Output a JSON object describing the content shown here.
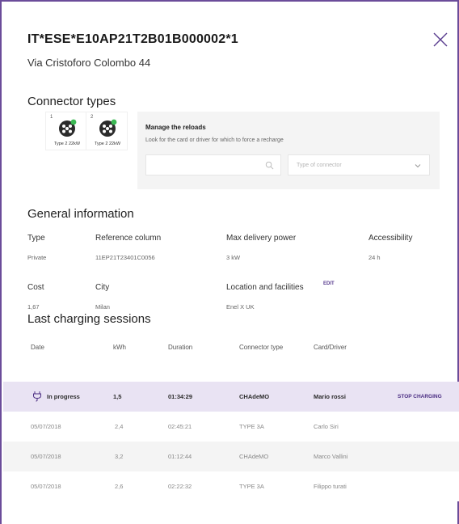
{
  "header": {
    "title": "IT*ESE*E10AP21T2B01B000002*1",
    "address": "Via Cristoforo Colombo 44"
  },
  "connectors": {
    "section_title": "Connector types",
    "items": [
      {
        "number": "1",
        "label": "Type 2 22kW"
      },
      {
        "number": "2",
        "label": "Type 2 22kW"
      }
    ],
    "colors": {
      "icon": "#2b2b2b",
      "status": "#3cba54"
    }
  },
  "reloads": {
    "title": "Manage the reloads",
    "description": "Look for the card or driver for which to force a recharge",
    "search_value": "",
    "connector_placeholder": "Type of connector"
  },
  "general": {
    "section_title": "General information",
    "fields": [
      {
        "label": "Type",
        "value": "Private"
      },
      {
        "label": "Reference column",
        "value": "11EP21T23401C0056"
      },
      {
        "label": "Max delivery power",
        "value": "3 kW"
      },
      {
        "label": "Accessibility",
        "value": "24 h"
      },
      {
        "label": "Cost",
        "value": "1,67"
      },
      {
        "label": "City",
        "value": "Milan"
      },
      {
        "label": "Location and facilities",
        "value": "Enel X UK"
      }
    ],
    "edit_label": "EDIT"
  },
  "sessions": {
    "section_title": "Last charging sessions",
    "columns": [
      "Date",
      "kWh",
      "Duration",
      "Connector type",
      "Card/Driver"
    ],
    "active": {
      "date": "In progress",
      "kwh": "1,5",
      "duration": "01:34:29",
      "connector": "CHAdeMO",
      "driver": "Mario rossi",
      "action": "STOP CHARGING"
    },
    "rows": [
      {
        "date": "05/07/2018",
        "kwh": "2,4",
        "duration": "02:45:21",
        "connector": "TYPE 3A",
        "driver": "Carlo Siri"
      },
      {
        "date": "05/07/2018",
        "kwh": "3,2",
        "duration": "01:12:44",
        "connector": "CHAdeMO",
        "driver": "Marco Vallini"
      },
      {
        "date": "05/07/2018",
        "kwh": "2,6",
        "duration": "02:22:32",
        "connector": "TYPE 3A",
        "driver": "Filippo turati"
      }
    ]
  },
  "theme": {
    "accent": "#6b4c9a",
    "active_row": "#e9e3f3",
    "stripe": "#f4f4f4"
  }
}
